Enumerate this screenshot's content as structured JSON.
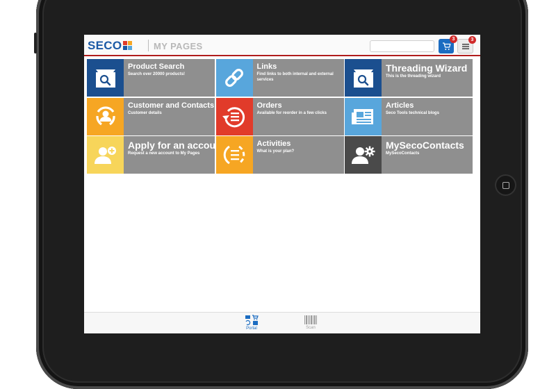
{
  "header": {
    "brand": "SECO",
    "page_title": "MY PAGES",
    "search": {
      "value": "",
      "placeholder": ""
    },
    "cart_badge": "3",
    "menu_badge": "3"
  },
  "tiles": [
    {
      "title": "Product Search",
      "desc": "Search over 20000 products!",
      "icon": "magnifier-window-icon",
      "color": "#1b4f8f"
    },
    {
      "title": "Links",
      "desc": "Find links to both internal and external services",
      "icon": "chain-link-icon",
      "color": "#58a6dc"
    },
    {
      "title": "Threading Wizard",
      "desc": "This is the threading wizard",
      "icon": "magnifier-window-icon",
      "color": "#1b4f8f"
    },
    {
      "title": "Customer and Contacts",
      "desc": "Customer details",
      "icon": "customer-icon",
      "color": "#f6a623"
    },
    {
      "title": "Orders",
      "desc": "Available for reorder in a few clicks",
      "icon": "reorder-icon",
      "color": "#e13b2a"
    },
    {
      "title": "Articles",
      "desc": "Seco Tools technical blogs",
      "icon": "newspaper-icon",
      "color": "#58a6dc"
    },
    {
      "title": "Apply for an account",
      "desc": "Request a new account to My Pages",
      "icon": "add-user-icon",
      "color": "#f7d55a"
    },
    {
      "title": "Activities",
      "desc": "What is your plan?",
      "icon": "activities-list-icon",
      "color": "#f6a623"
    },
    {
      "title": "MySecoContacts",
      "desc": "MySecoContacts",
      "icon": "user-settings-icon",
      "color": "#4a4a4a"
    }
  ],
  "bottom_nav": {
    "portal_label": "Portal",
    "scan_label": "Scan"
  }
}
